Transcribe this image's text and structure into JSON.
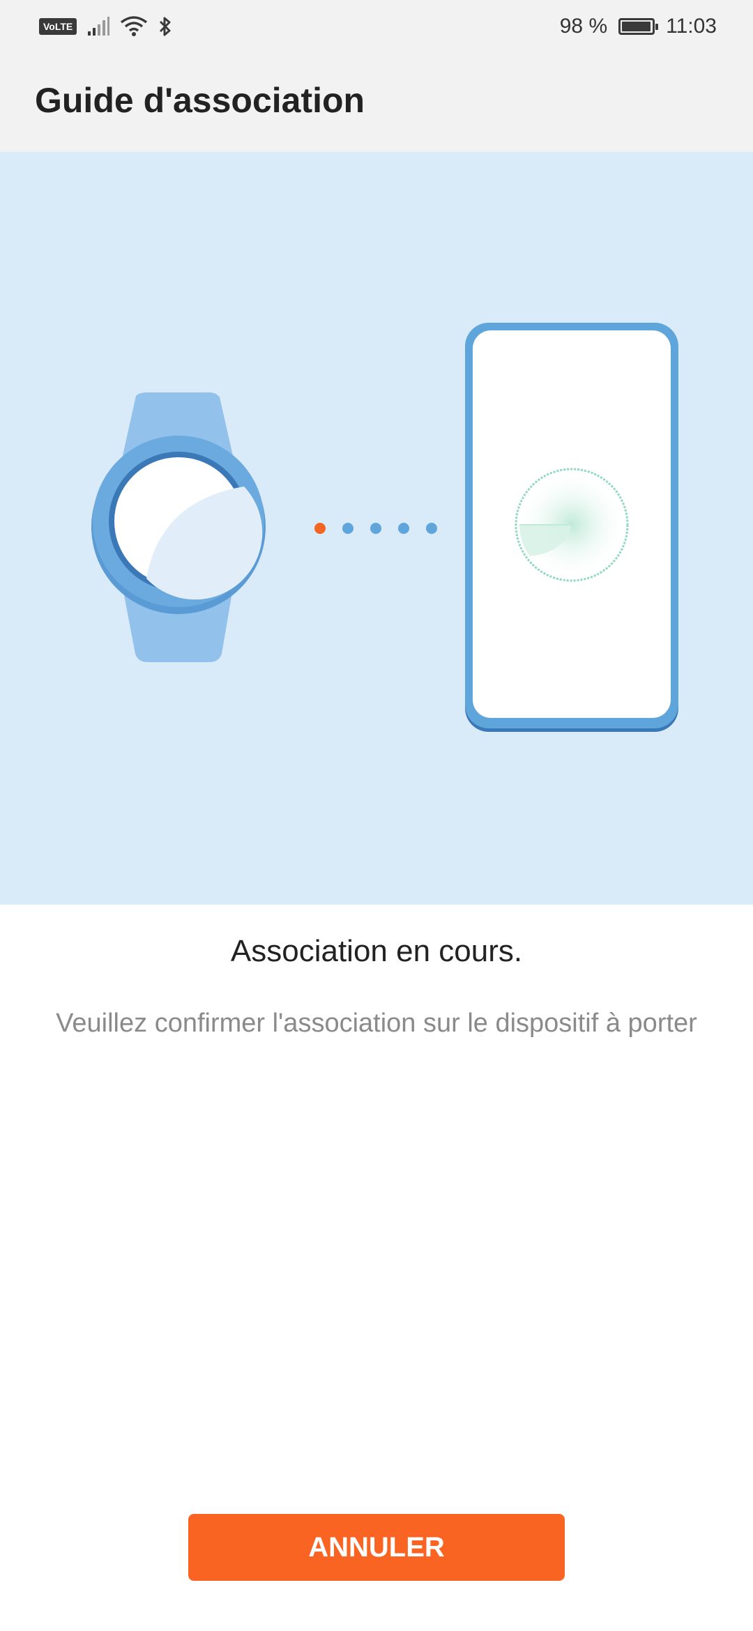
{
  "status_bar": {
    "network_badge": "VoLTE",
    "battery_text": "98 %",
    "battery_level": 0.98,
    "time": "11:03",
    "icons": [
      "volte-icon",
      "signal-icon",
      "wifi-icon",
      "bluetooth-icon",
      "battery-icon"
    ]
  },
  "header": {
    "title": "Guide d'association"
  },
  "illustration": {
    "watch_icon": "smartwatch-icon",
    "phone_icon": "smartphone-icon",
    "scan_icon": "radar-scan-icon",
    "dots_count": 5,
    "active_dot_index": 0,
    "colors": {
      "background": "#d9eaf8",
      "watch_band": "#92c2eb",
      "watch_bezel": "#6aaade",
      "watch_ring_dark": "#3a78b8",
      "phone_frame": "#5ea5dc",
      "dot_active": "#f26522",
      "dot_inactive": "#5ea5dc",
      "scan_color": "#8fd9bd"
    }
  },
  "content": {
    "status_title": "Association en cours.",
    "status_subtitle": "Veuillez confirmer l'association sur le dispositif à porter"
  },
  "actions": {
    "cancel_label": "ANNULER",
    "accent_color": "#fa6423"
  }
}
